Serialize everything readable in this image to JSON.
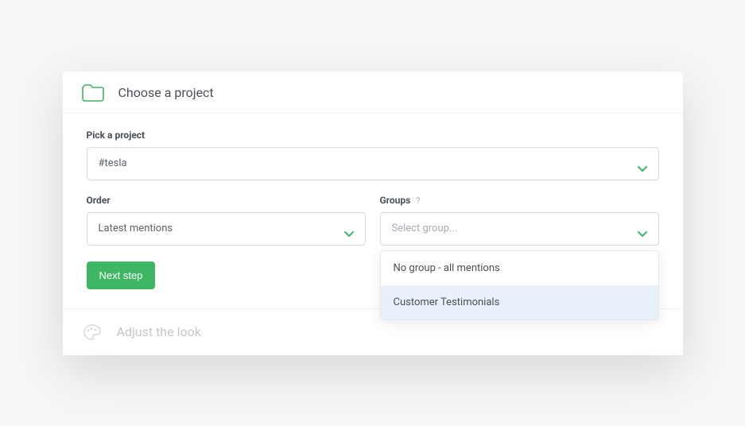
{
  "step1": {
    "title": "Choose a project",
    "project_label": "Pick a project",
    "project_value": "#tesla",
    "order_label": "Order",
    "order_value": "Latest mentions",
    "groups_label": "Groups",
    "groups_help": "?",
    "groups_placeholder": "Select group...",
    "groups_options": [
      {
        "label": "No group - all mentions"
      },
      {
        "label": "Customer Testimonials"
      }
    ],
    "next_button": "Next step"
  },
  "step2": {
    "title": "Adjust the look"
  }
}
